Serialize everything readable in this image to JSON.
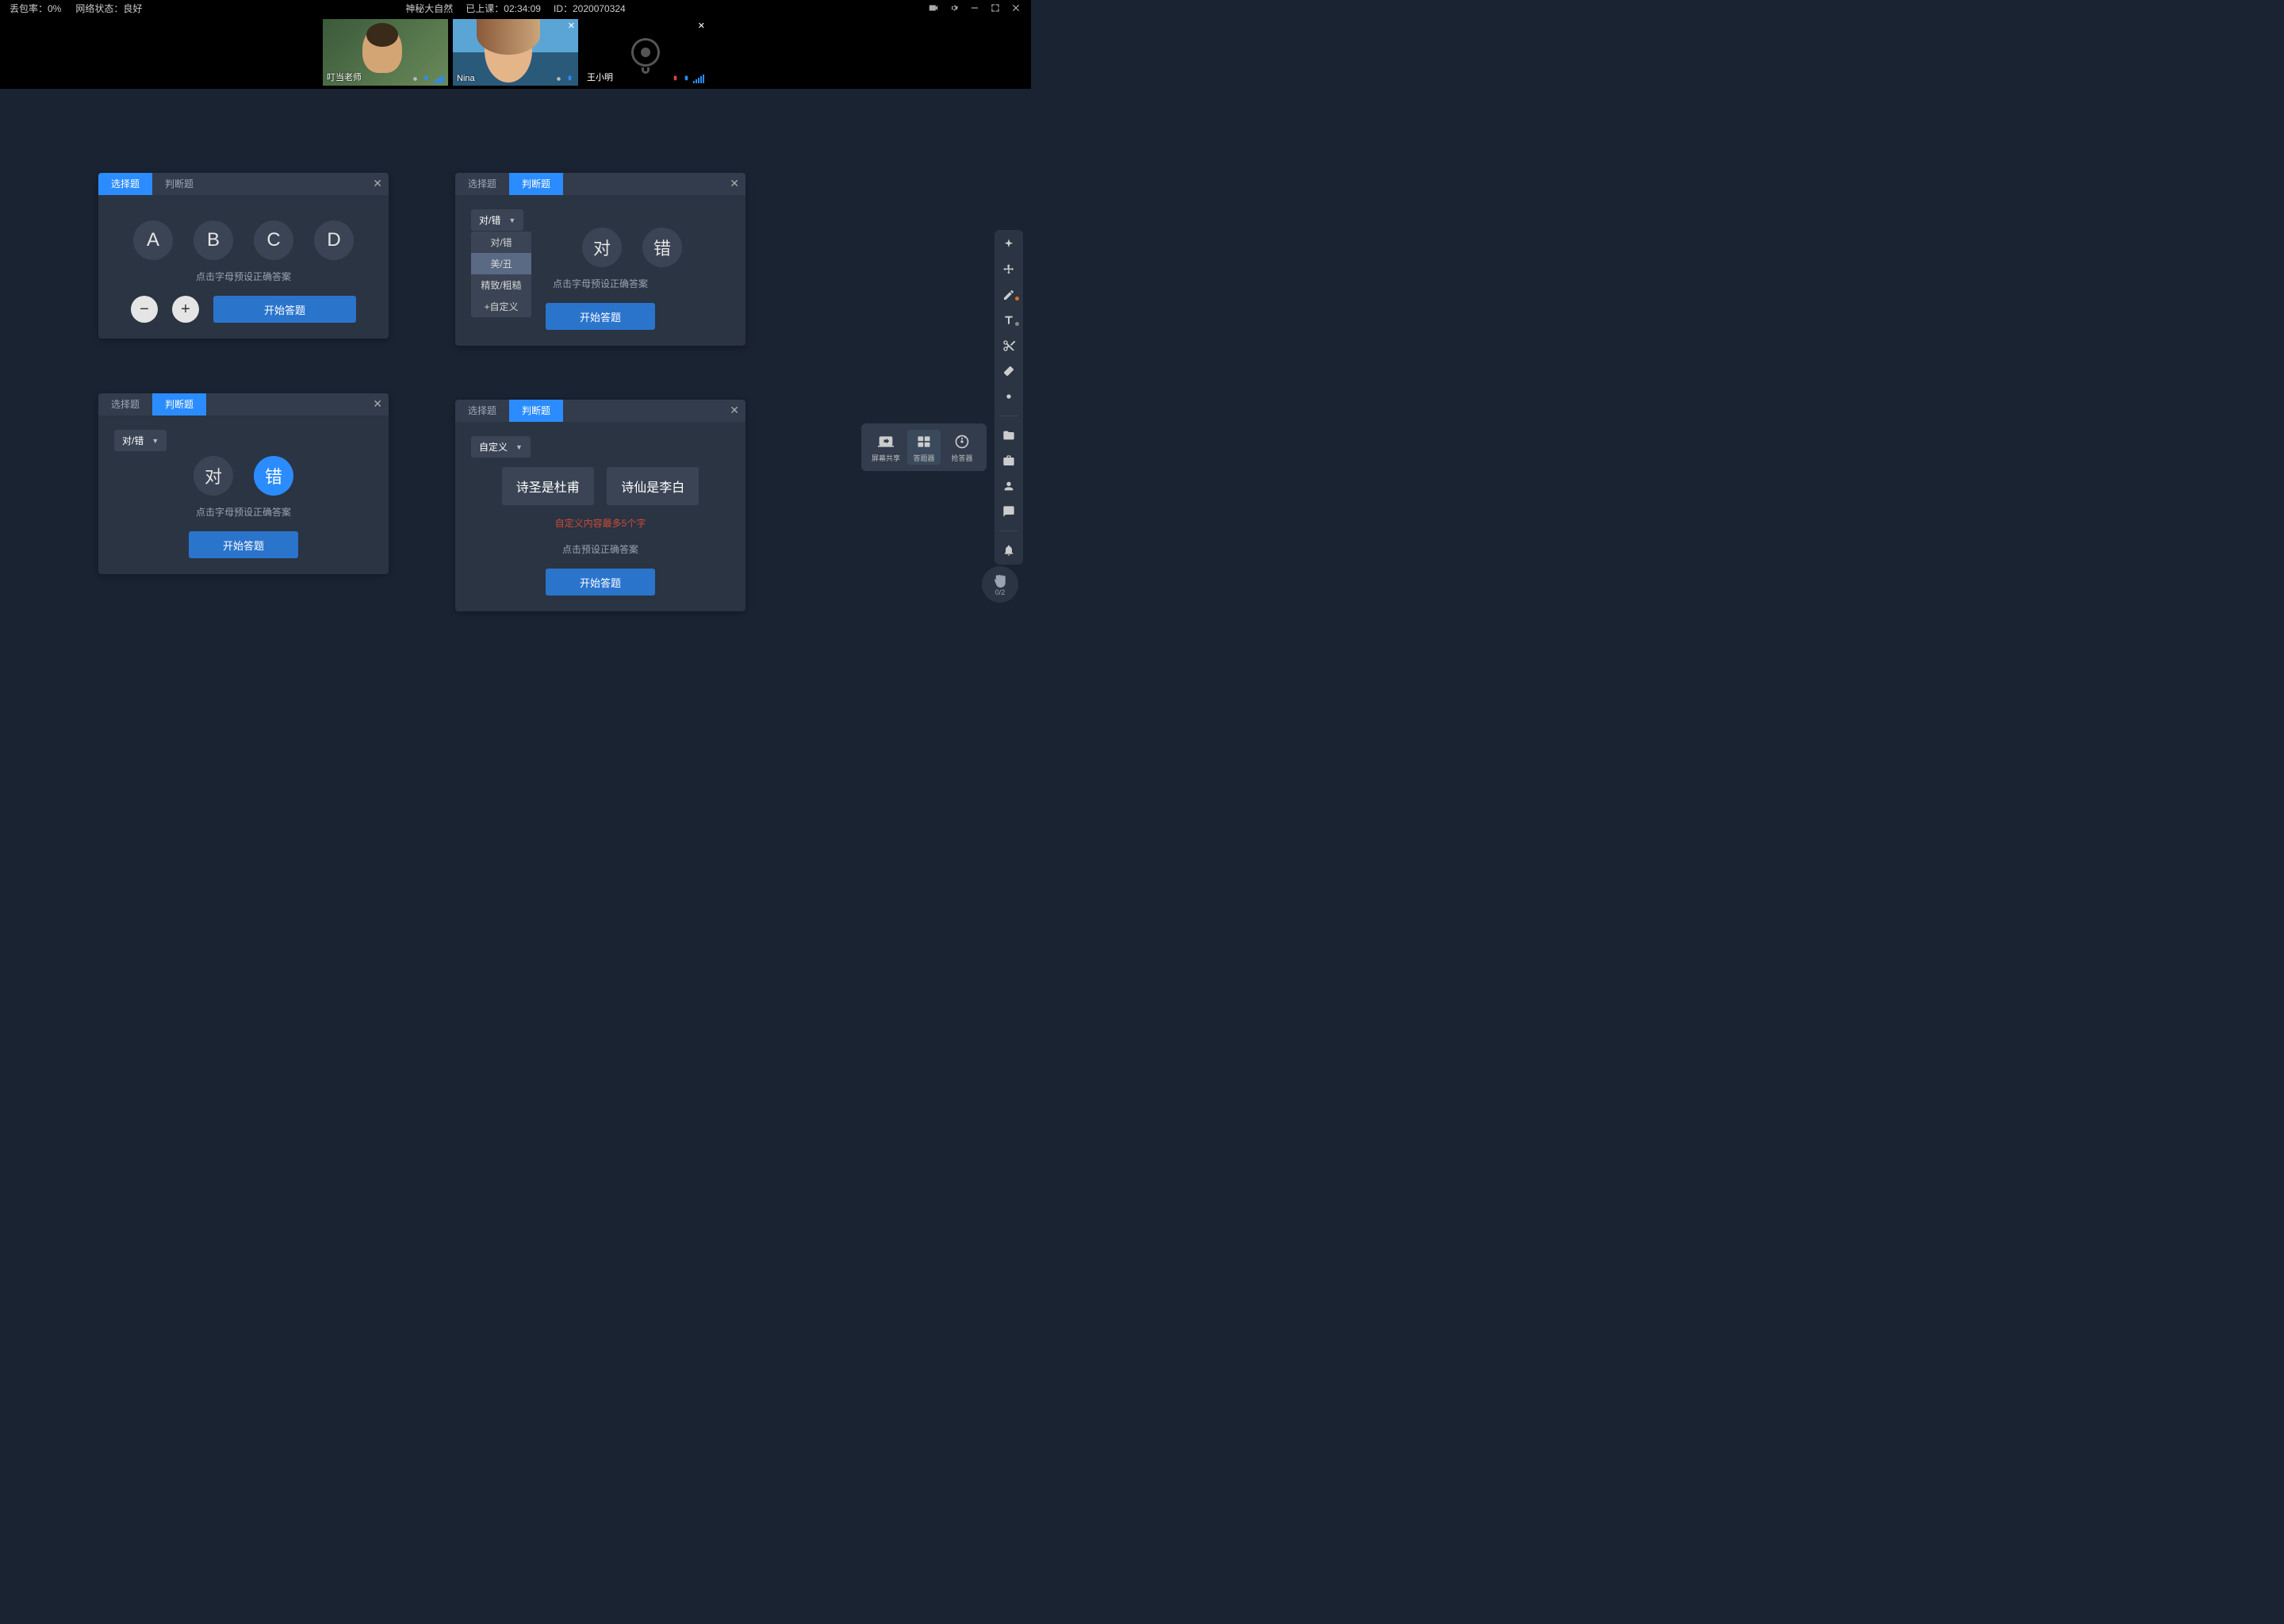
{
  "topbar": {
    "packet_loss_label": "丢包率：0%",
    "network_label": "网络状态：良好",
    "title": "神秘大自然",
    "elapsed_label": "已上课：02:34:09",
    "id_label": "ID：2020070324"
  },
  "videos": {
    "tile1_name": "叮当老师",
    "tile2_name": "Nina",
    "tile3_name": "王小明"
  },
  "panel1": {
    "tab1": "选择题",
    "tab2": "判断题",
    "optA": "A",
    "optB": "B",
    "optC": "C",
    "optD": "D",
    "hint": "点击字母预设正确答案",
    "minus": "−",
    "plus": "+",
    "start": "开始答题"
  },
  "panel2": {
    "tab1": "选择题",
    "tab2": "判断题",
    "dropdown_label": "对/错",
    "menu": {
      "m1": "对/错",
      "m2": "美/丑",
      "m3": "精致/粗糙",
      "m4": "+自定义"
    },
    "opt1": "对",
    "opt2": "错",
    "hint": "点击字母预设正确答案",
    "start": "开始答题"
  },
  "panel3": {
    "tab1": "选择题",
    "tab2": "判断题",
    "dropdown_label": "对/错",
    "opt1": "对",
    "opt2": "错",
    "hint": "点击字母预设正确答案",
    "start": "开始答题"
  },
  "panel4": {
    "tab1": "选择题",
    "tab2": "判断题",
    "dropdown_label": "自定义",
    "opt1": "诗圣是杜甫",
    "opt2": "诗仙是李白",
    "warn": "自定义内容最多5个字",
    "hint": "点击预设正确答案",
    "start": "开始答题"
  },
  "popup": {
    "screen_share": "屏幕共享",
    "answer_tool": "答题器",
    "buzzer": "抢答器"
  },
  "hand": {
    "count": "0/2"
  }
}
